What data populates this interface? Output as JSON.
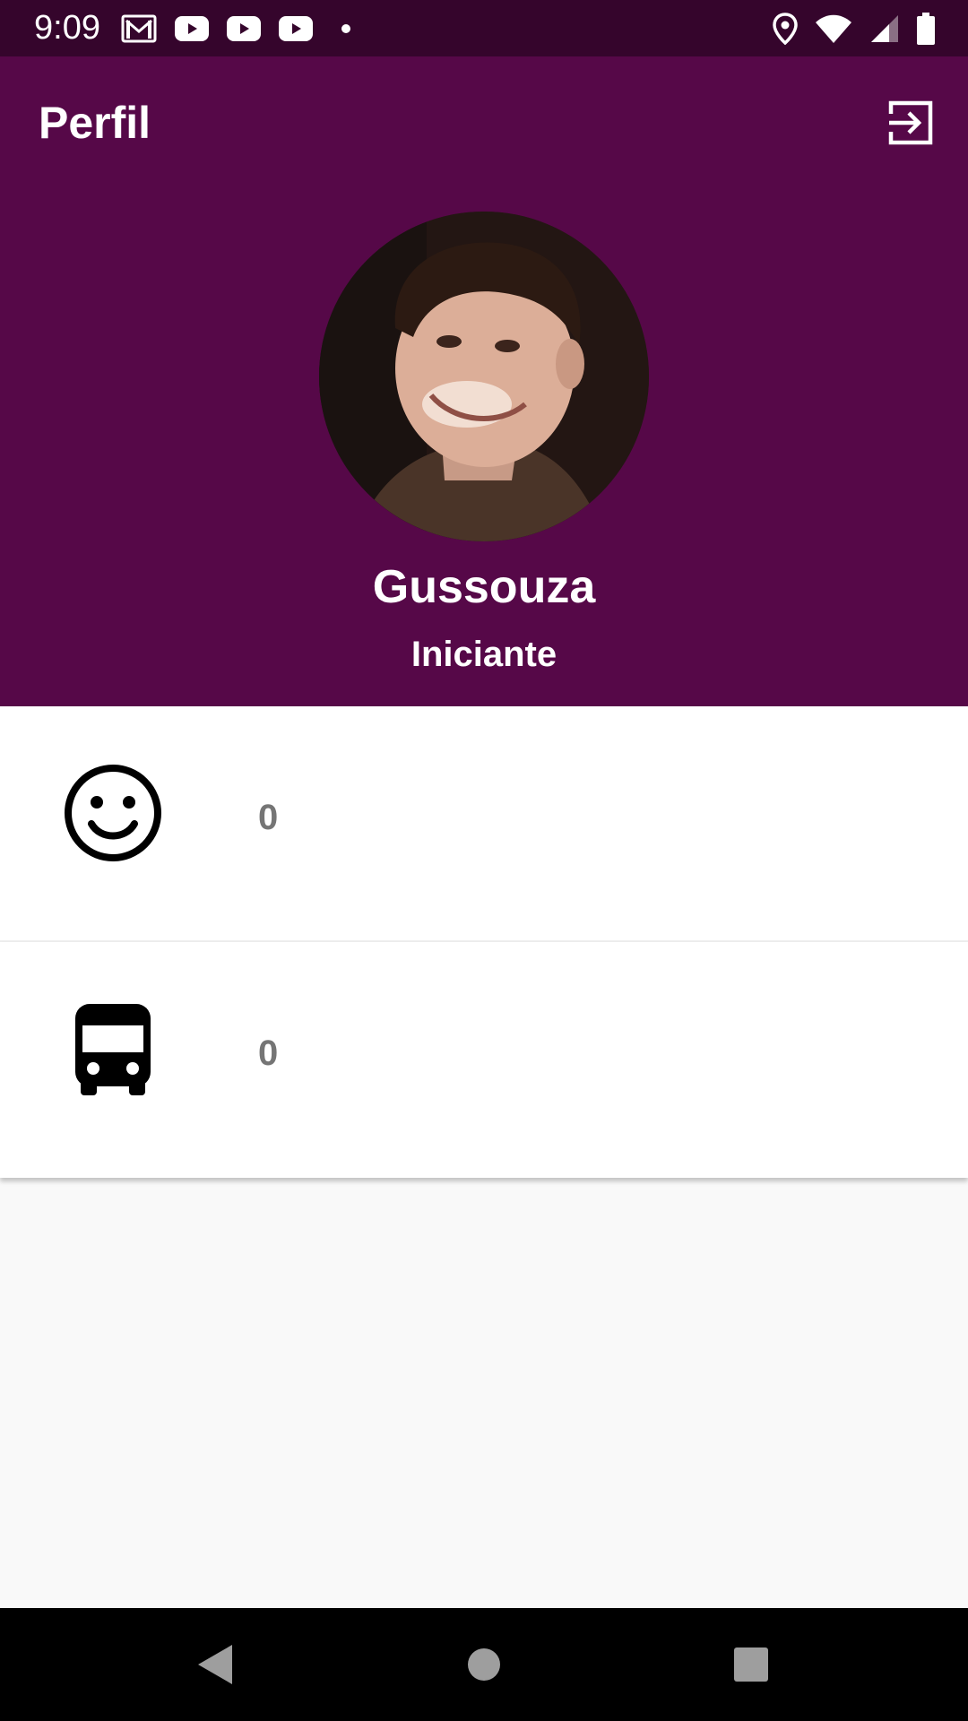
{
  "status_bar": {
    "time": "9:09",
    "left_icons": [
      "gmail-icon",
      "youtube-icon",
      "youtube-icon",
      "youtube-icon",
      "dot-icon"
    ],
    "right_icons": [
      "location-icon",
      "wifi-icon",
      "signal-icon",
      "battery-icon"
    ]
  },
  "header": {
    "title": "Perfil",
    "logout_icon": "logout-icon",
    "background_color": "#560848"
  },
  "profile": {
    "name": "Gussouza",
    "level": "Iniciante"
  },
  "stats": [
    {
      "icon": "smiley-icon",
      "value": "0"
    },
    {
      "icon": "bus-icon",
      "value": "0"
    }
  ],
  "nav_bar": {
    "buttons": [
      "back-icon",
      "home-icon",
      "recents-icon"
    ]
  }
}
